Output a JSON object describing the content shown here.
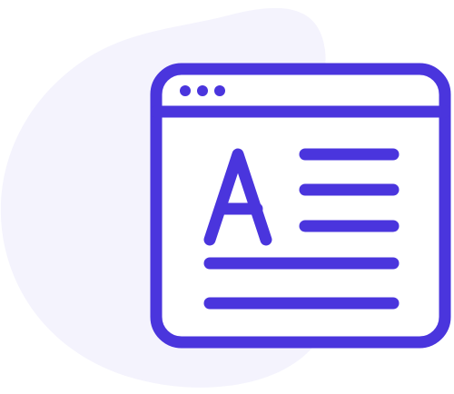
{
  "illustration": {
    "icon": "browser-window-text-document-icon",
    "letter": "A",
    "colors": {
      "stroke": "#4A35DD",
      "blob": "#F4F3FD",
      "window_fill": "#FFFFFF"
    }
  }
}
